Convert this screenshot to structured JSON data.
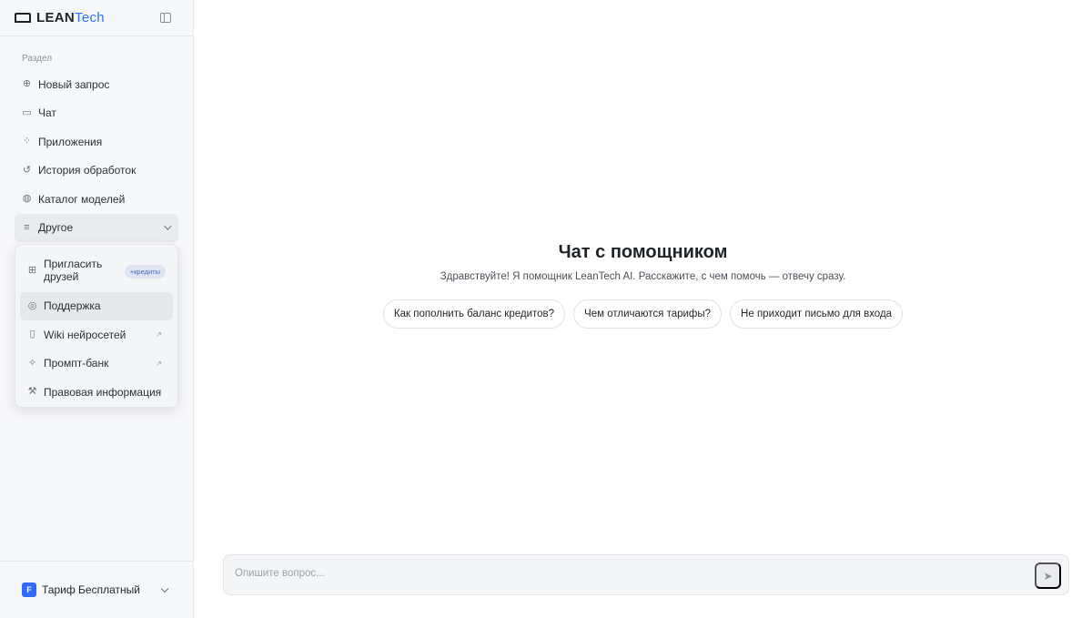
{
  "brand": {
    "name_main": "LEAN",
    "name_accent": "Tech"
  },
  "sidebar": {
    "section_label": "Раздел",
    "items": [
      {
        "label": "Новый запрос",
        "icon": "plus-circle-icon"
      },
      {
        "label": "Чат",
        "icon": "message-icon"
      },
      {
        "label": "Приложения",
        "icon": "grid-icon"
      },
      {
        "label": "История обработок",
        "icon": "history-icon"
      },
      {
        "label": "Каталог моделей",
        "icon": "globe-icon"
      },
      {
        "label": "Другое",
        "icon": "menu-icon"
      }
    ]
  },
  "popup_menu": {
    "items": [
      {
        "label": "Пригласить друзей",
        "badge": "+кредиты",
        "icon": "gift-icon"
      },
      {
        "label": "Поддержка",
        "icon": "support-icon"
      },
      {
        "label": "Wiki нейросетей",
        "icon": "book-icon",
        "ext": "↗"
      },
      {
        "label": "Промпт-банк",
        "icon": "sparkle-icon",
        "ext": "↗"
      },
      {
        "label": "Правовая информация",
        "icon": "gavel-icon",
        "ext": "↗"
      }
    ]
  },
  "plan": {
    "badge": "F",
    "label": "Тариф Бесплатный"
  },
  "main": {
    "title": "Чат с помощником",
    "subtitle": "Здравствуйте! Я помощник LeanTech AI. Расскажите, с чем помочь — отвечу сразу.",
    "suggestions": [
      "Как пополнить баланс кредитов?",
      "Чем отличаются тарифы?",
      "Не приходит письмо для входа"
    ],
    "composer": {
      "placeholder": "Опишите вопрос..."
    }
  },
  "colors": {
    "accent": "#2f6bff",
    "sidebar_bg": "#f6f7f9"
  }
}
